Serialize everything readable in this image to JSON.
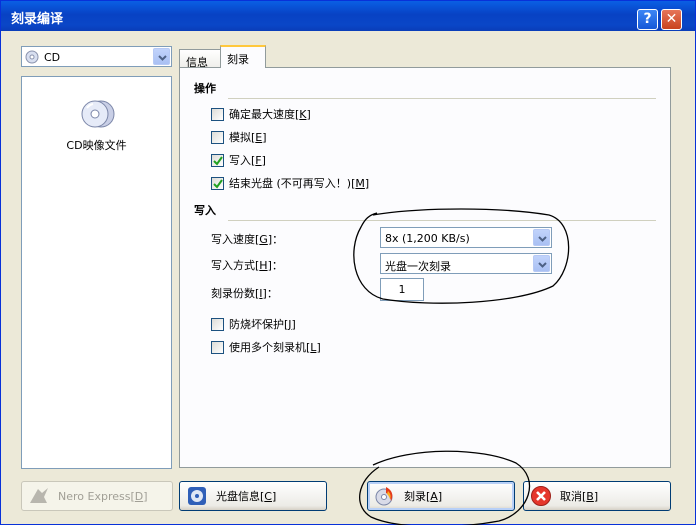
{
  "window": {
    "title": "刻录编译",
    "help_glyph": "?",
    "close_glyph": "✕"
  },
  "device": {
    "selected": "CD"
  },
  "compilation": {
    "items": [
      {
        "label": "CD映像文件",
        "icon": "cd-image-icon"
      }
    ]
  },
  "tabs": [
    {
      "label": "信息",
      "active": false
    },
    {
      "label": "刻录",
      "active": true
    }
  ],
  "operations": {
    "title": "操作",
    "options": [
      {
        "label": "确定最大速度",
        "key": "K",
        "checked": false
      },
      {
        "label": "模拟",
        "key": "E",
        "checked": false
      },
      {
        "label": "写入",
        "key": "F",
        "checked": true
      },
      {
        "label": "结束光盘 (不可再写入！)",
        "key": "M",
        "checked": true
      }
    ]
  },
  "write": {
    "title": "写入",
    "speed_label": "写入速度",
    "speed_key": "G",
    "speed_value": "8x (1,200 KB/s)",
    "method_label": "写入方式",
    "method_key": "H",
    "method_value": "光盘一次刻录",
    "copies_label": "刻录份数",
    "copies_key": "I",
    "copies_value": "1",
    "options": [
      {
        "label": "防烧坏保护",
        "key": "J",
        "checked": false
      },
      {
        "label": "使用多个刻录机",
        "key": "L",
        "checked": false
      }
    ]
  },
  "buttons": {
    "nero_express": {
      "label": "Nero Express",
      "key": "D",
      "enabled": false
    },
    "disc_info": {
      "label": "光盘信息",
      "key": "C"
    },
    "burn": {
      "label": "刻录",
      "key": "A"
    },
    "cancel": {
      "label": "取消",
      "key": "B"
    }
  },
  "colors": {
    "titlebar": "#0842c4",
    "check": "#21a121",
    "focus_tab": "#ffc83c",
    "ink": "#000000"
  }
}
